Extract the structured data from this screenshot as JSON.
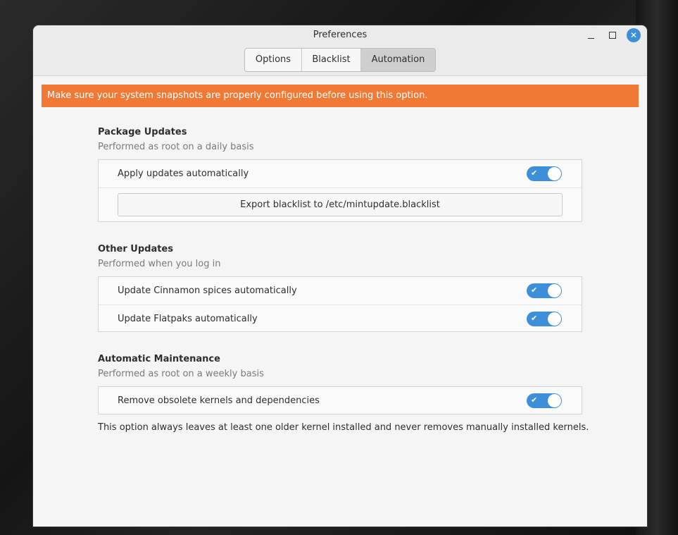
{
  "window": {
    "title": "Preferences"
  },
  "tabs": [
    {
      "label": "Options",
      "active": false
    },
    {
      "label": "Blacklist",
      "active": false
    },
    {
      "label": "Automation",
      "active": true
    }
  ],
  "banner": {
    "text": "Make sure your system snapshots are properly configured before using this option.",
    "color": "#f07a35"
  },
  "sections": {
    "package_updates": {
      "title": "Package Updates",
      "subtitle": "Performed as root on a daily basis",
      "apply_updates": {
        "label": "Apply updates automatically",
        "enabled": true
      },
      "export_button": "Export blacklist to /etc/mintupdate.blacklist"
    },
    "other_updates": {
      "title": "Other Updates",
      "subtitle": "Performed when you log in",
      "cinnamon": {
        "label": "Update Cinnamon spices automatically",
        "enabled": true
      },
      "flatpaks": {
        "label": "Update Flatpaks automatically",
        "enabled": true
      }
    },
    "maintenance": {
      "title": "Automatic Maintenance",
      "subtitle": "Performed as root on a weekly basis",
      "kernels": {
        "label": "Remove obsolete kernels and dependencies",
        "enabled": true
      },
      "note": "This option always leaves at least one older kernel installed and never removes manually installed kernels."
    }
  },
  "colors": {
    "accent": "#3d8fd9",
    "active_tab": "#cfcfcf"
  },
  "icons": {
    "minimize": "minimize-icon",
    "maximize": "maximize-icon",
    "close": "close-icon",
    "check": "check-icon"
  }
}
